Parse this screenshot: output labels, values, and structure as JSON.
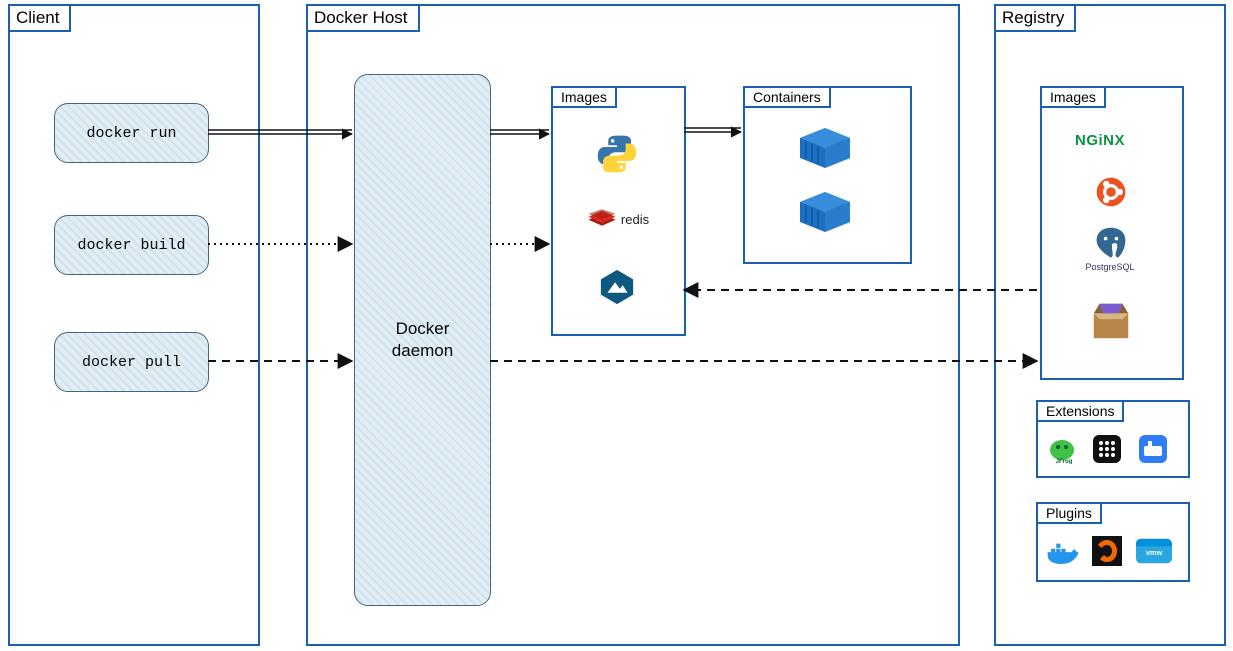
{
  "client": {
    "title": "Client",
    "commands": [
      "docker run",
      "docker build",
      "docker pull"
    ]
  },
  "host": {
    "title": "Docker Host",
    "daemon_label": "Docker daemon",
    "images": {
      "title": "Images",
      "items": [
        "python",
        "redis",
        "alpine"
      ]
    },
    "containers": {
      "title": "Containers",
      "count": 2
    }
  },
  "registry": {
    "title": "Registry",
    "images": {
      "title": "Images",
      "items": [
        "NGINX",
        "ubuntu",
        "PostgreSQL",
        "package-box"
      ]
    },
    "extensions": {
      "title": "Extensions",
      "items": [
        "jfrog",
        "portainer",
        "rancher"
      ]
    },
    "plugins": {
      "title": "Plugins",
      "items": [
        "docker-whale",
        "grafana",
        "vmware"
      ]
    }
  },
  "arrows": [
    {
      "from": "docker run",
      "to": "daemon",
      "style": "solid"
    },
    {
      "from": "daemon",
      "to": "images",
      "style": "solid",
      "context": "run"
    },
    {
      "from": "images",
      "to": "containers",
      "style": "solid"
    },
    {
      "from": "docker build",
      "to": "daemon",
      "style": "dotted"
    },
    {
      "from": "daemon",
      "to": "images",
      "style": "dotted",
      "context": "build"
    },
    {
      "from": "docker pull",
      "to": "daemon",
      "style": "dashed"
    },
    {
      "from": "daemon",
      "to": "registry.images",
      "style": "dashed"
    },
    {
      "from": "registry.images",
      "to": "host.images",
      "style": "dashed",
      "direction": "back"
    }
  ]
}
